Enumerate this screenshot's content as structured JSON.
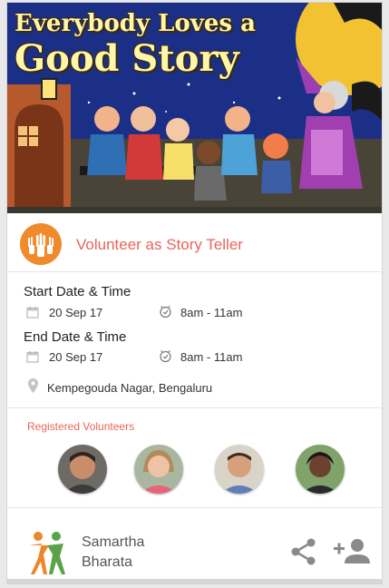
{
  "banner": {
    "title_line1": "Everybody Loves a",
    "title_line2": "Good Story"
  },
  "event": {
    "logo_icon": "raised-hands-icon",
    "title": "Volunteer as Story Teller",
    "title_color": "#e8655c",
    "logo_color": "#f08a2a"
  },
  "start": {
    "label": "Start Date & Time",
    "date": "20 Sep 17",
    "time": "8am - 11am"
  },
  "end": {
    "label": "End Date & Time",
    "date": "20 Sep 17",
    "time": "8am - 11am"
  },
  "location": {
    "icon": "location-pin-icon",
    "text": "Kempegouda Nagar, Bengaluru"
  },
  "volunteers": {
    "title": "Registered Volunteers",
    "count_shown": 4
  },
  "organization": {
    "name_line1": "Samartha",
    "name_line2": "Bharata"
  },
  "actions": {
    "share_icon": "share-icon",
    "add_person_icon": "add-person-icon"
  }
}
